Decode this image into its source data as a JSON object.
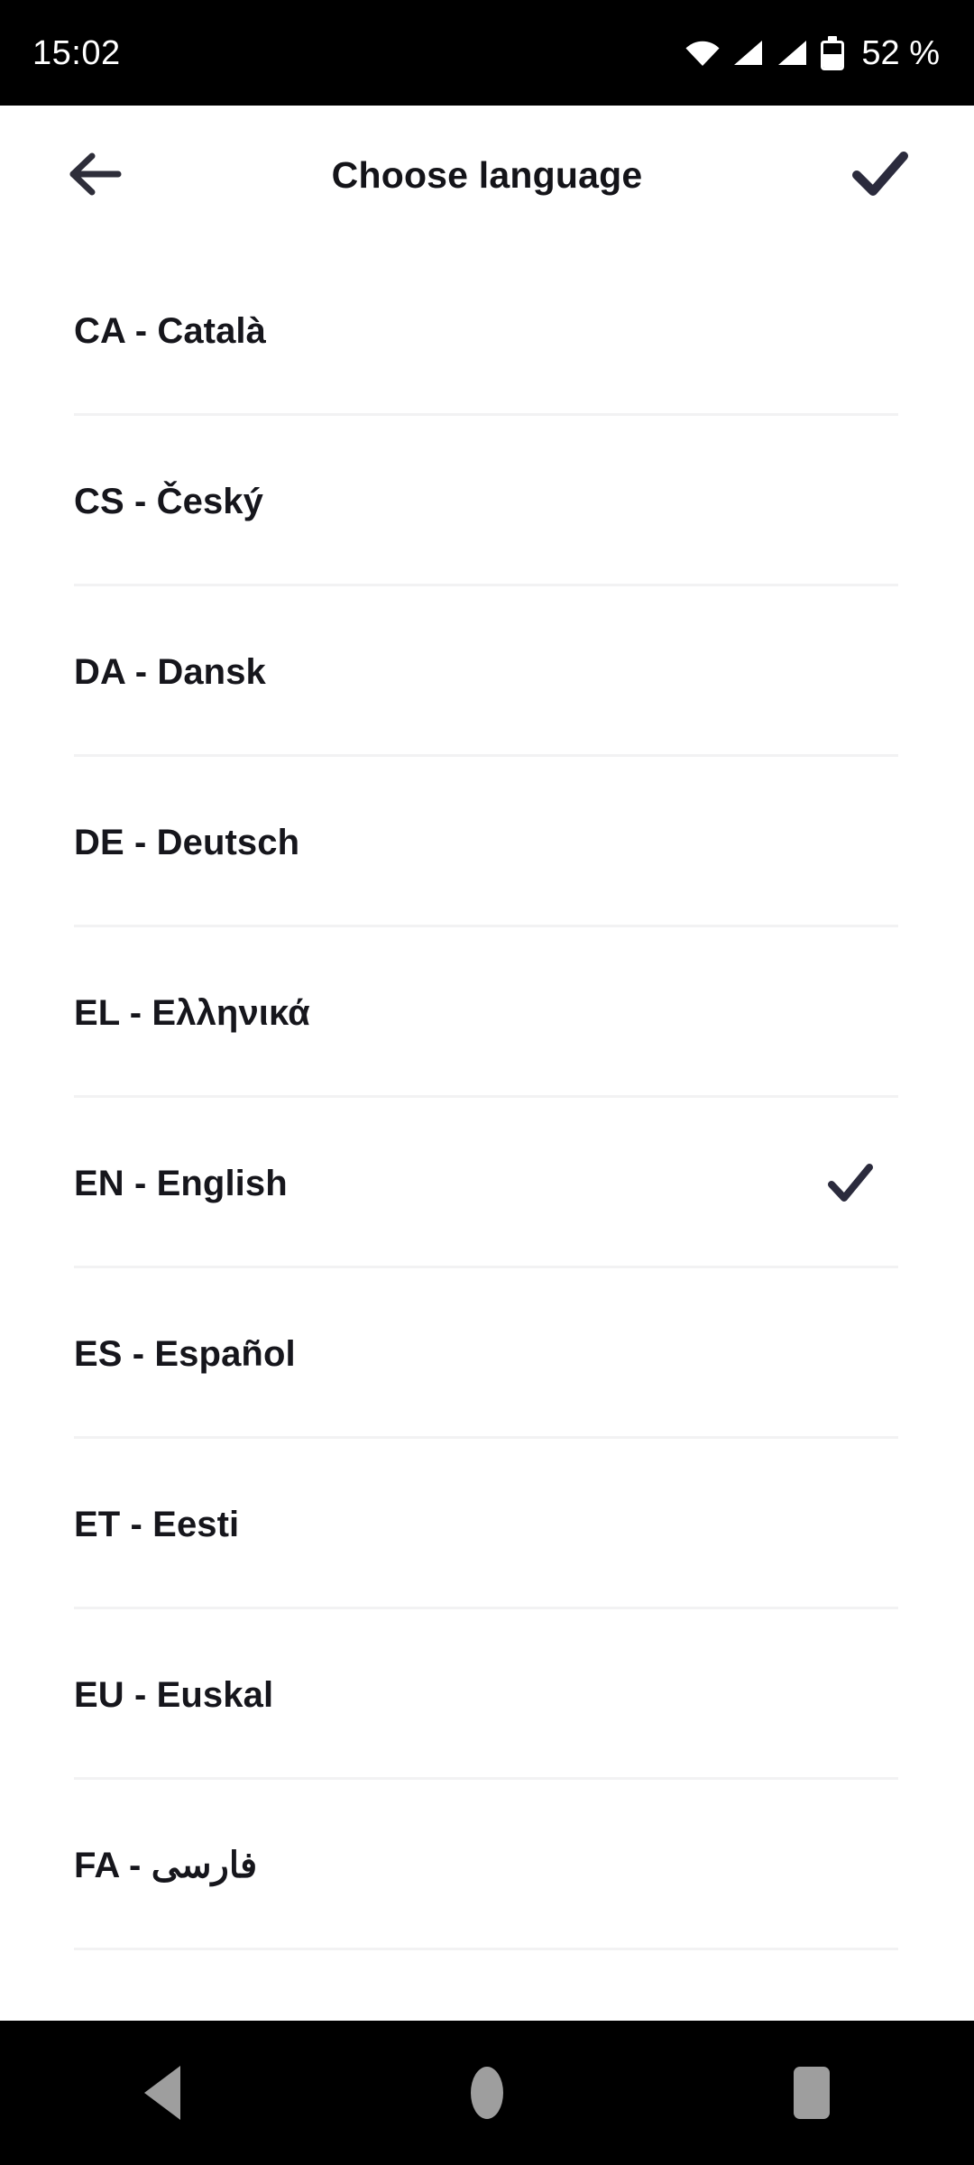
{
  "status_bar": {
    "time": "15:02",
    "battery_percent": "52 %",
    "icons": [
      "wifi-icon",
      "signal-icon",
      "signal-icon",
      "battery-icon"
    ],
    "background_color": "#000000",
    "foreground_color": "#ffffff"
  },
  "app_bar": {
    "title": "Choose language",
    "back_icon": "arrow-left-icon",
    "confirm_icon": "check-icon",
    "icon_color": "#2e2e3a",
    "title_color": "#141419"
  },
  "language_list": {
    "selected_code": "EN",
    "check_icon": "check-icon",
    "divider_color": "#f2f2f3",
    "items": [
      {
        "label": "CA - Català",
        "code": "CA",
        "selected": false
      },
      {
        "label": "CS - Český",
        "code": "CS",
        "selected": false
      },
      {
        "label": "DA - Dansk",
        "code": "DA",
        "selected": false
      },
      {
        "label": "DE - Deutsch",
        "code": "DE",
        "selected": false
      },
      {
        "label": "EL - Ελληνικά",
        "code": "EL",
        "selected": false
      },
      {
        "label": "EN - English",
        "code": "EN",
        "selected": true
      },
      {
        "label": "ES - Español",
        "code": "ES",
        "selected": false
      },
      {
        "label": "ET - Eesti",
        "code": "ET",
        "selected": false
      },
      {
        "label": "EU - Euskal",
        "code": "EU",
        "selected": false
      },
      {
        "label": "FA - فارسی",
        "code": "FA",
        "selected": false
      }
    ]
  },
  "nav_bar": {
    "background_color": "#000000",
    "icon_color": "#9e9e9e",
    "buttons": [
      {
        "name": "nav-back-button",
        "icon": "triangle-back-icon"
      },
      {
        "name": "nav-home-button",
        "icon": "circle-home-icon"
      },
      {
        "name": "nav-recents-button",
        "icon": "square-recents-icon"
      }
    ]
  }
}
